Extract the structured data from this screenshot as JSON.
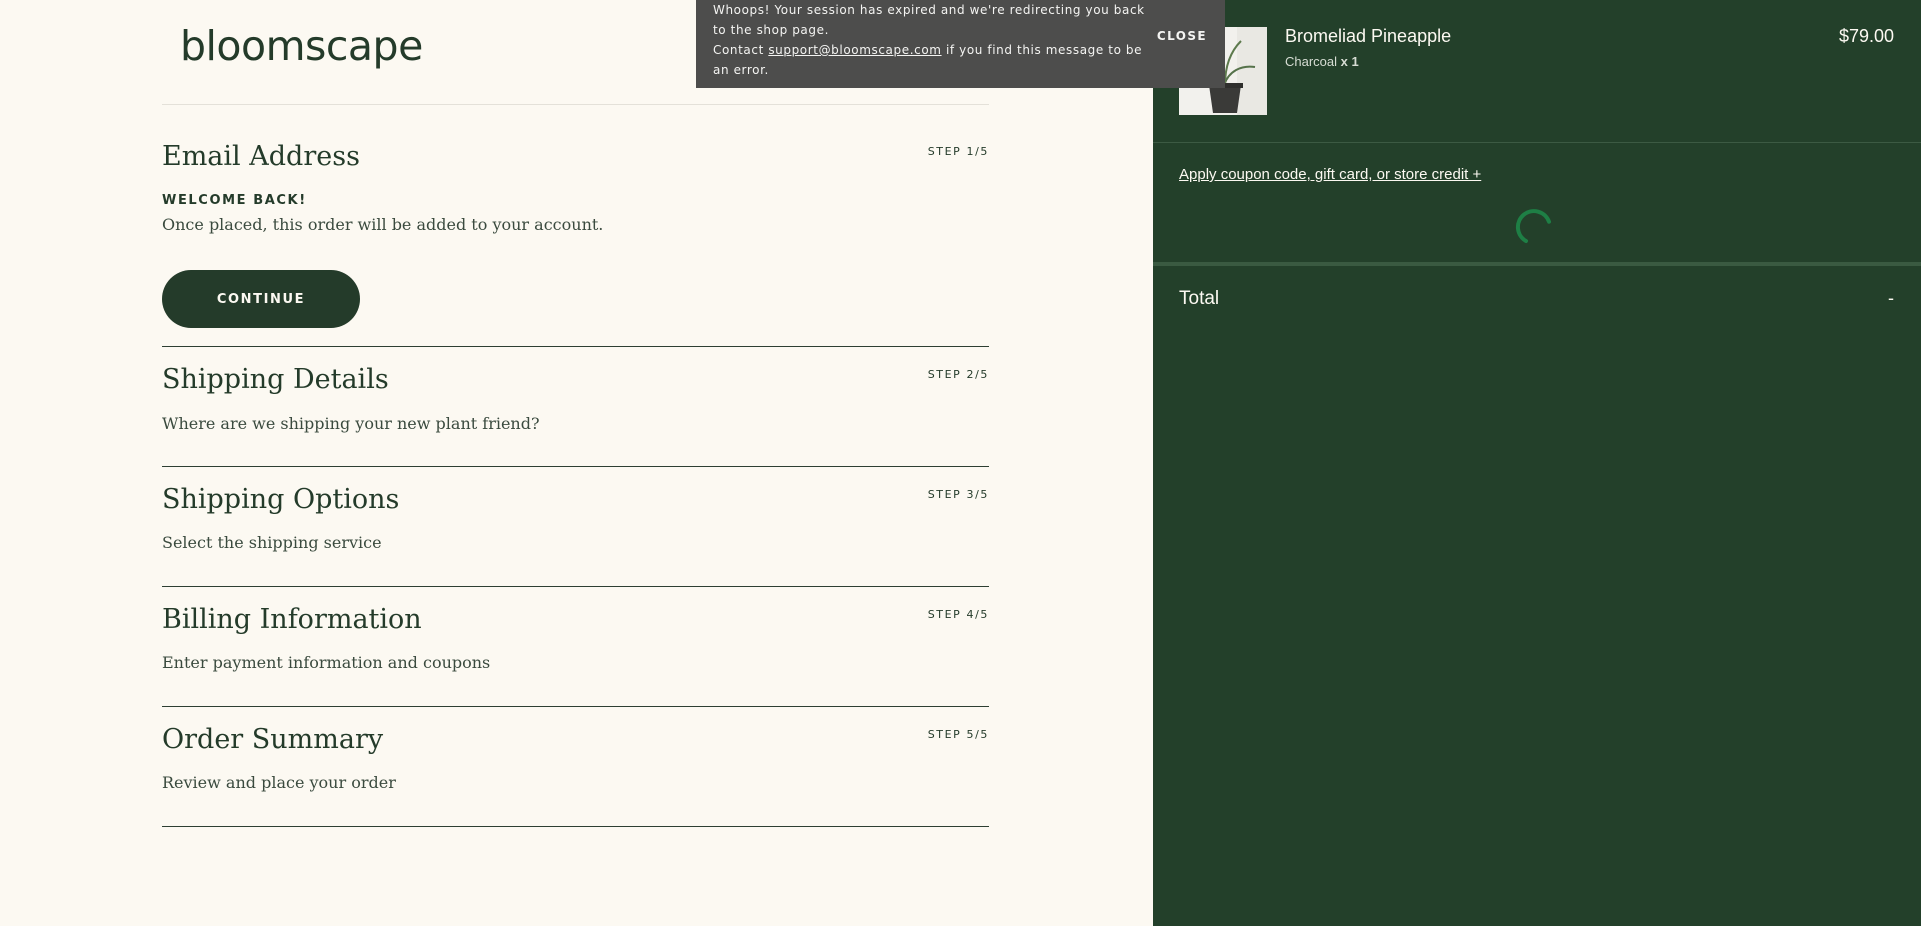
{
  "brand": {
    "logo_text": "bloomscape"
  },
  "toast": {
    "line1": "Whoops! Your session has expired and we're redirecting you back to the shop page.",
    "contact_prefix": "Contact ",
    "email": "support@bloomscape.com",
    "contact_suffix": " if you find this message to be an error.",
    "close_label": "CLOSE"
  },
  "steps": [
    {
      "title": "Email Address",
      "step": "STEP 1/5",
      "welcome": "WELCOME BACK!",
      "desc": "Once placed, this order will be added to your account.",
      "button": "CONTINUE"
    },
    {
      "title": "Shipping Details",
      "step": "STEP 2/5",
      "desc": "Where are we shipping your new plant friend?"
    },
    {
      "title": "Shipping Options",
      "step": "STEP 3/5",
      "desc": "Select the shipping service"
    },
    {
      "title": "Billing Information",
      "step": "STEP 4/5",
      "desc": "Enter payment information and coupons"
    },
    {
      "title": "Order Summary",
      "step": "STEP 5/5",
      "desc": "Review and place your order"
    }
  ],
  "cart": {
    "item": {
      "name": "Bromeliad Pineapple",
      "variant": "Charcoal",
      "qty": "x 1",
      "price": "$79.00",
      "image_icon": "plant-thumbnail"
    },
    "coupon_link": "Apply coupon code, gift card, or store credit +",
    "total_label": "Total",
    "total_value": "-"
  },
  "colors": {
    "cream": "#fcf9f2",
    "forest": "#243b2a",
    "panel": "#23402a",
    "toast": "#4d4d4c",
    "spinner": "#1e7f45"
  }
}
